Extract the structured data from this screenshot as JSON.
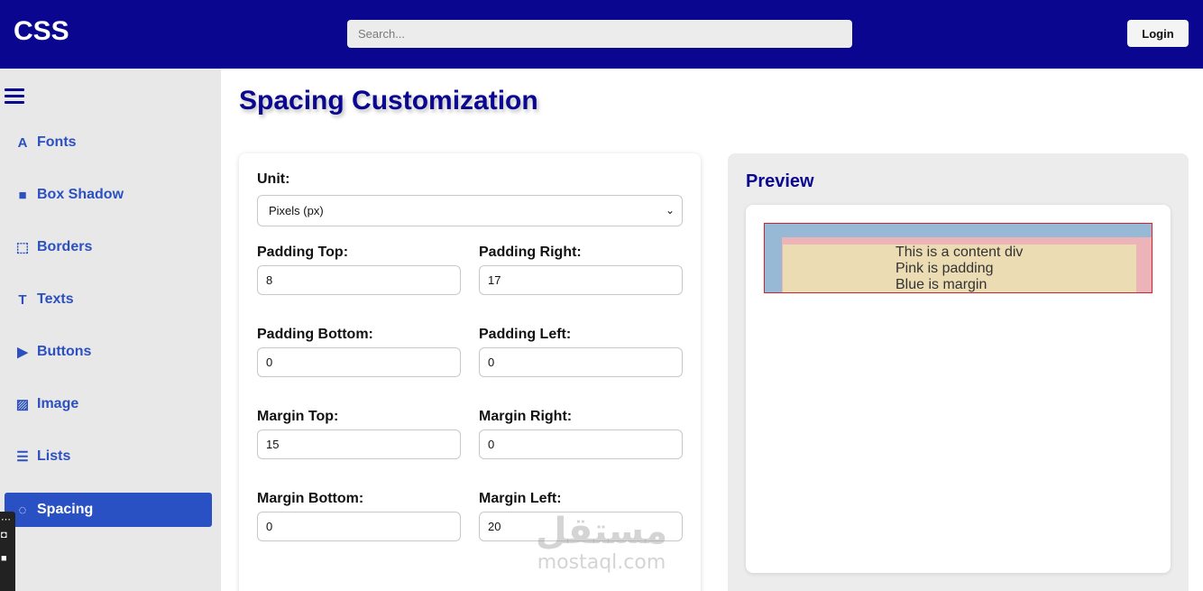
{
  "header": {
    "logo": "CSS",
    "search_placeholder": "Search...",
    "login_label": "Login"
  },
  "sidebar": {
    "menu_icon": "hamburger-icon",
    "items": [
      {
        "label": "Fonts",
        "icon": "font-icon",
        "glyph": "A"
      },
      {
        "label": "Box Shadow",
        "icon": "square-icon",
        "glyph": "■"
      },
      {
        "label": "Borders",
        "icon": "dotted-border-icon",
        "glyph": "⬚"
      },
      {
        "label": "Texts",
        "icon": "text-icon",
        "glyph": "T"
      },
      {
        "label": "Buttons",
        "icon": "play-icon",
        "glyph": "▶"
      },
      {
        "label": "Image",
        "icon": "image-icon",
        "glyph": "▨"
      },
      {
        "label": "Lists",
        "icon": "list-icon",
        "glyph": "☰"
      },
      {
        "label": "Spacing",
        "icon": "spinner-icon",
        "glyph": "◌",
        "active": true
      }
    ]
  },
  "main": {
    "title": "Spacing Customization"
  },
  "form": {
    "unit_label": "Unit:",
    "unit_value": "Pixels (px)",
    "padding_top_label": "Padding Top:",
    "padding_top_value": "8",
    "padding_right_label": "Padding Right:",
    "padding_right_value": "17",
    "padding_bottom_label": "Padding Bottom:",
    "padding_bottom_value": "0",
    "padding_left_label": "Padding Left:",
    "padding_left_value": "0",
    "margin_top_label": "Margin Top:",
    "margin_top_value": "15",
    "margin_right_label": "Margin Right:",
    "margin_right_value": "0",
    "margin_bottom_label": "Margin Bottom:",
    "margin_bottom_value": "0",
    "margin_left_label": "Margin Left:",
    "margin_left_value": "20"
  },
  "preview": {
    "title": "Preview",
    "line1": "This is a content div",
    "line2": "Pink is padding",
    "line3": "Blue is margin"
  },
  "watermark": {
    "arabic": "مستقل",
    "latin": "mostaql.com"
  },
  "colors": {
    "brand": "#0b0690",
    "accent": "#2a51c4",
    "margin_blue": "#98b9d6",
    "padding_pink": "#ecb3b9",
    "content_beige": "#ecdcb4",
    "border_red": "#d81f2a"
  }
}
